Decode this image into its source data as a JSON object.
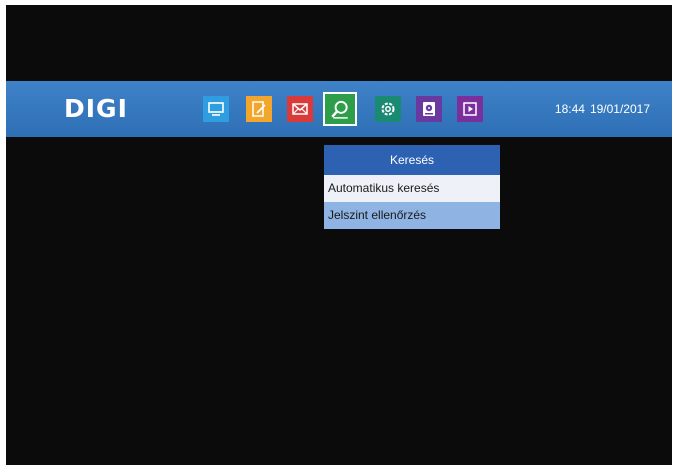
{
  "topbar": {
    "logo": "DIGI",
    "time": "18:44",
    "date": "19/01/2017",
    "tiles": [
      {
        "name": "tv-tile",
        "icon": "tv-icon",
        "color": "#2f9ee0",
        "selected": false
      },
      {
        "name": "edit-tile",
        "icon": "edit-icon",
        "color": "#f2a62b",
        "selected": false
      },
      {
        "name": "mail-tile",
        "icon": "mail-icon",
        "color": "#d93a3a",
        "selected": false
      },
      {
        "name": "search-tile",
        "icon": "search-icon",
        "color": "#2f9e4a",
        "selected": true
      },
      {
        "name": "settings-tile",
        "icon": "gear-icon",
        "color": "#1b8a73",
        "selected": false
      },
      {
        "name": "storage-tile",
        "icon": "hard-disk-icon",
        "color": "#6a39a0",
        "selected": false
      },
      {
        "name": "media-tile",
        "icon": "play-icon",
        "color": "#7a2f9c",
        "selected": false
      }
    ]
  },
  "menu": {
    "title": "Keresés",
    "items": [
      {
        "label": "Automatikus keresés",
        "active": false
      },
      {
        "label": "Jelszint ellenőrzés",
        "active": true
      }
    ]
  }
}
